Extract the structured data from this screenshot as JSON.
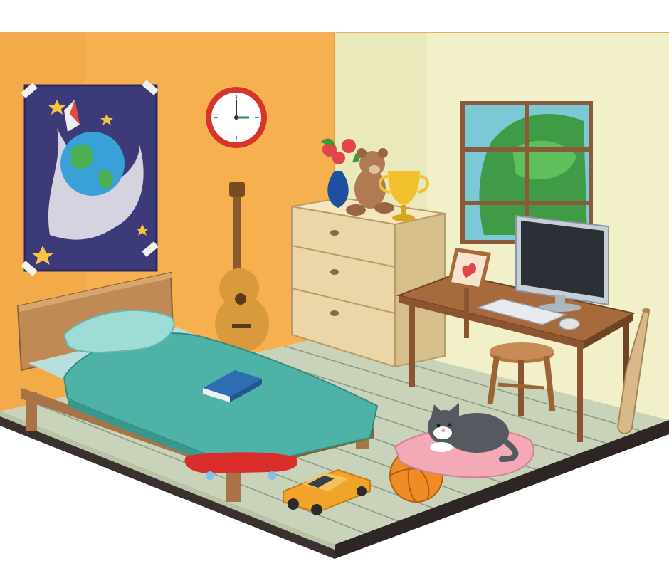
{
  "scene": {
    "kind": "cartoon-bedroom-illustration",
    "objects": [
      "space-poster",
      "wall-clock",
      "guitar",
      "bed",
      "book",
      "dresser",
      "flower-vase",
      "teddy-bear",
      "trophy",
      "window",
      "desk",
      "computer-monitor",
      "keyboard",
      "mouse",
      "picture-frame",
      "stool",
      "baseball-bat",
      "cat-on-cushion",
      "basketball",
      "toy-car",
      "skateboard"
    ]
  },
  "clock": {
    "hour": 3,
    "minute": 0
  },
  "colors": {
    "left_wall": "#f6b04f",
    "right_wall": "#f1f0c8",
    "floor": "#c9d3b9",
    "floor_lines": "#8a9a84",
    "floor_edge": "#3b3030",
    "blanket": "#4fb2a6",
    "bed_wood": "#c08a55",
    "dresser": "#ead6a6",
    "desk_wood": "#a66a3c",
    "cat": "#555a60",
    "basketball": "#f08c25",
    "toy_car": "#f0a42a",
    "skateboard": "#d92d2b",
    "poster_bg": "#3d3a7a",
    "monitor": "#c7cfd6"
  }
}
